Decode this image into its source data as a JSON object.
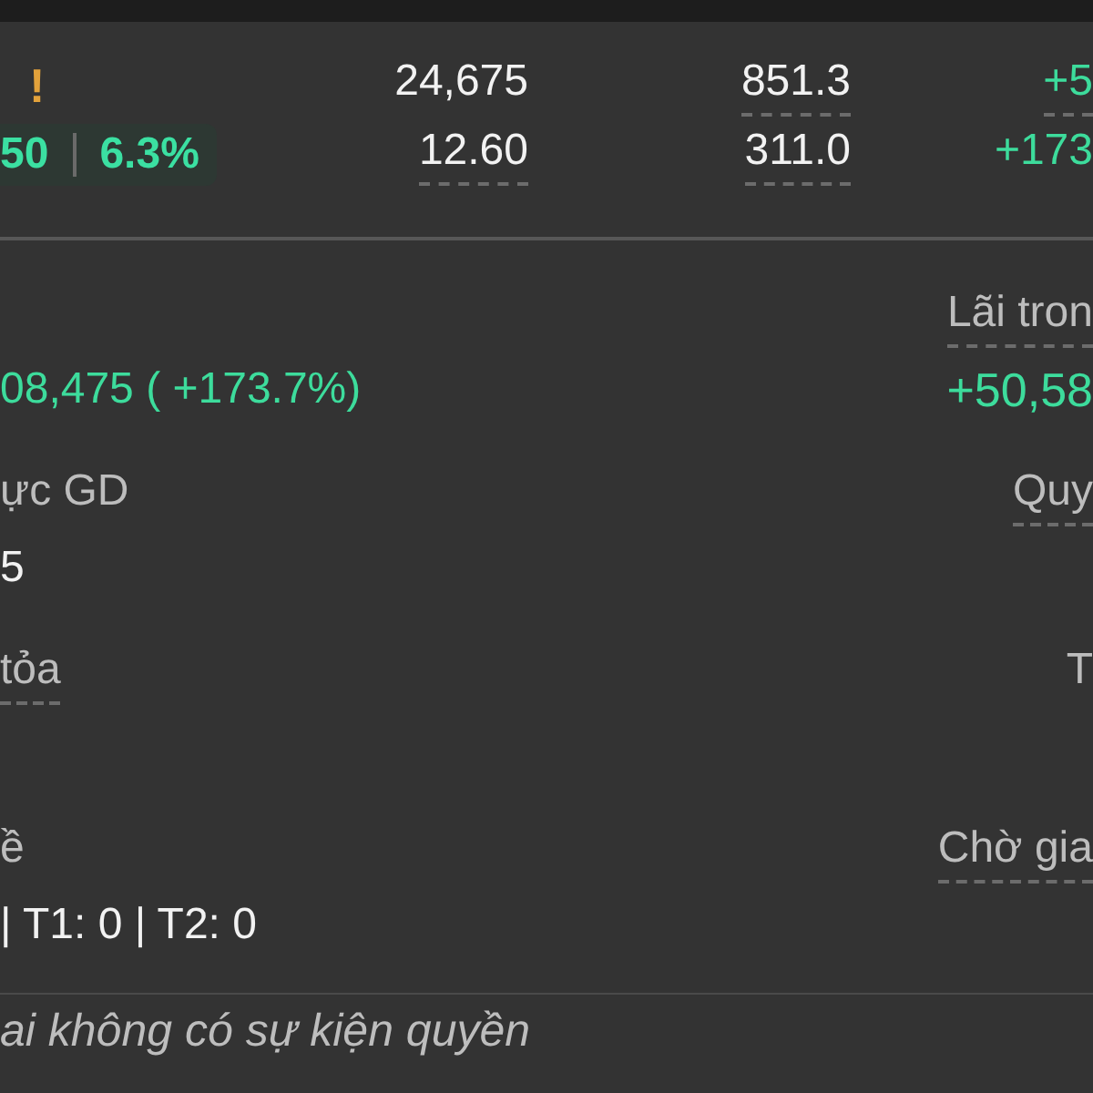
{
  "positions": {
    "rows": [
      {
        "flag": "!",
        "cells": [
          {
            "text": "24,675",
            "underlined": false,
            "gain": false
          },
          {
            "text": "851.3",
            "underlined": true,
            "gain": false
          },
          {
            "text": "+5",
            "underlined": true,
            "gain": true
          }
        ]
      },
      {
        "badge": {
          "value": "50",
          "percent": "6.3%"
        },
        "cells": [
          {
            "text": "12.60",
            "underlined": true,
            "gain": false
          },
          {
            "text": "311.0",
            "underlined": true,
            "gain": false
          },
          {
            "text": "+173",
            "underlined": false,
            "gain": true
          }
        ]
      }
    ]
  },
  "details": {
    "rows": [
      {
        "left": {
          "value": "08,475 ( +173.7%)",
          "gain": true
        },
        "right": {
          "label": "Lãi tron",
          "underlined": true,
          "value": "+50,58",
          "gain": true
        }
      },
      {
        "left": {
          "label": "ực GD",
          "underlined": false,
          "value": "5",
          "gain": false
        },
        "right": {
          "label": "Quy",
          "underlined": true
        }
      },
      {
        "left": {
          "label": "tỏa",
          "underlined": true
        },
        "right": {
          "label": "T",
          "underlined": false
        }
      },
      {
        "left": {
          "label": "ề",
          "underlined": false,
          "value": "| T1: 0 | T2: 0",
          "gain": false
        },
        "right": {
          "label": "Chờ gia",
          "underlined": true
        }
      }
    ]
  },
  "note": "ai không có sự kiện quyền"
}
